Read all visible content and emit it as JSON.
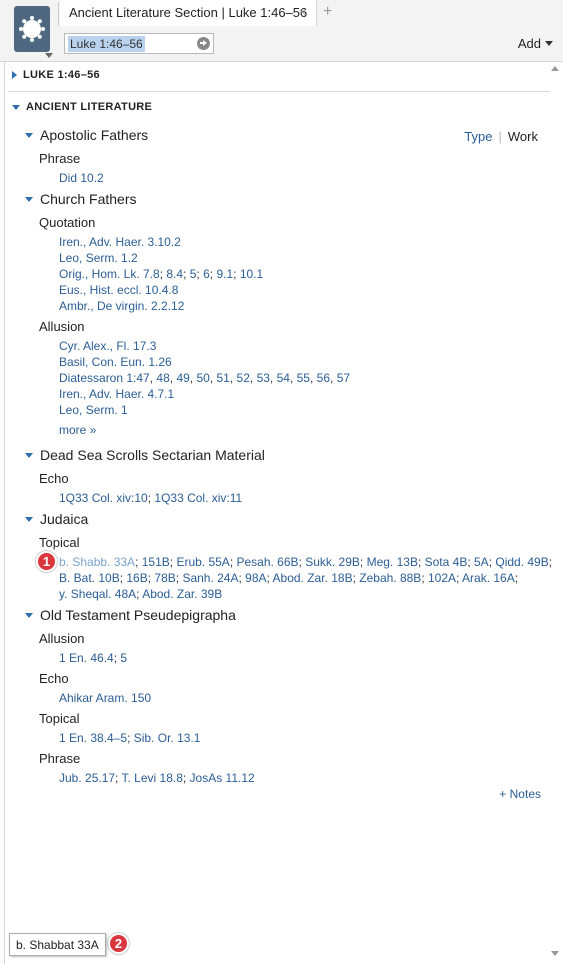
{
  "header": {
    "tab_title": "Ancient Literature Section | Luke 1:46–56",
    "tab_close": "×",
    "tab_add": "+",
    "reference_value": "Luke 1:46–56",
    "add_label": "Add"
  },
  "sections": {
    "luke": "LUKE 1:46–56",
    "ancient": "ANCIENT LITERATURE"
  },
  "view_toggle": {
    "type": "Type",
    "divider": "|",
    "work": "Work"
  },
  "groups": {
    "apostolic": {
      "title": "Apostolic Fathers",
      "phrase": {
        "label": "Phrase",
        "lines": [
          [
            "Did 10.2"
          ]
        ]
      }
    },
    "church": {
      "title": "Church Fathers",
      "quotation": {
        "label": "Quotation",
        "lines": [
          [
            "Iren., Adv. Haer. 3.10.2"
          ],
          [
            "Leo, Serm. 1.2"
          ],
          [
            "Orig., Hom. Lk. 7.8",
            "8.4",
            "5",
            "6",
            "9.1",
            "10.1"
          ],
          [
            "Eus., Hist. eccl. 10.4.8"
          ],
          [
            "Ambr., De virgin. 2.2.12"
          ]
        ]
      },
      "allusion": {
        "label": "Allusion",
        "lines": [
          [
            "Cyr. Alex., Fl. 17.3"
          ],
          [
            "Basil, Con. Eun. 1.26"
          ],
          [
            "Diatessaron 1:47",
            "48",
            "49",
            "50",
            "51",
            "52",
            "53",
            "54",
            "55",
            "56",
            "57"
          ],
          [
            "Iren., Adv. Haer. 4.7.1"
          ],
          [
            "Leo, Serm. 1"
          ]
        ],
        "more": "more »"
      }
    },
    "dss": {
      "title": "Dead Sea Scrolls Sectarian Material",
      "echo": {
        "label": "Echo",
        "lines": [
          [
            "1Q33 Col. xiv:10",
            "1Q33 Col. xiv:11"
          ]
        ]
      }
    },
    "judaica": {
      "title": "Judaica",
      "topical": {
        "label": "Topical",
        "lines": [
          [
            "b. Shabb. 33A",
            "151B",
            "Erub. 55A",
            "Pesah. 66B",
            "Sukk. 29B",
            "Meg. 13B",
            "Sota 4B",
            "5A",
            "Qidd. 49B"
          ],
          [
            "B. Bat. 10B",
            "16B",
            "78B",
            "Sanh. 24A",
            "98A",
            "Abod. Zar. 18B",
            "Zebah. 88B",
            "102A",
            "Arak. 16A"
          ],
          [
            "y. Sheqal. 48A",
            "Abod. Zar. 39B"
          ]
        ]
      }
    },
    "otp": {
      "title": "Old Testament Pseudepigrapha",
      "allusion": {
        "label": "Allusion",
        "lines": [
          [
            "1 En. 46.4",
            "5"
          ]
        ]
      },
      "echo": {
        "label": "Echo",
        "lines": [
          [
            "Ahikar Aram. 150"
          ]
        ]
      },
      "topical": {
        "label": "Topical",
        "lines": [
          [
            "1 En. 38.4–5",
            "Sib. Or. 13.1"
          ]
        ]
      },
      "phrase": {
        "label": "Phrase",
        "lines": [
          [
            "Jub. 25.17",
            "T. Levi 18.8",
            "JosAs 11.12"
          ]
        ]
      }
    }
  },
  "notes_link": "+ Notes",
  "callouts": [
    "1",
    "2"
  ],
  "tooltip": "b. Shabbat 33A",
  "colors": {
    "link": "#2b5e96",
    "link_hover": "#7aa3cc",
    "triangle": "#2d6fb0",
    "badge": "#d9363e",
    "logo_bg": "#4e6882"
  },
  "icons": [
    "app-logo-icon",
    "go-arrow-icon",
    "collapse-triangle-icon",
    "expand-triangle-icon",
    "close-icon",
    "plus-icon",
    "chevron-down-icon"
  ]
}
